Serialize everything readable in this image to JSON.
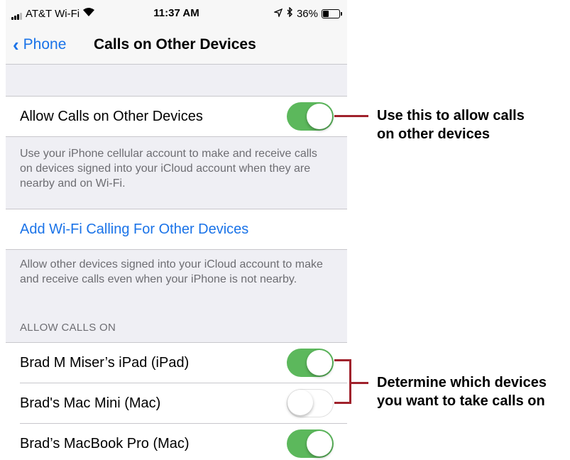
{
  "status_bar": {
    "carrier": "AT&T Wi-Fi",
    "time": "11:37 AM",
    "battery": "36%"
  },
  "nav": {
    "back_label": "Phone",
    "title": "Calls on Other Devices"
  },
  "allow_calls": {
    "label": "Allow Calls on Other Devices",
    "enabled": true,
    "footer": "Use your iPhone cellular account to make and receive calls on devices signed into your iCloud account when they are nearby and on Wi-Fi."
  },
  "wifi_calling": {
    "label": "Add Wi-Fi Calling For Other Devices",
    "footer": "Allow other devices signed into your iCloud account to make and receive calls even when your iPhone is not nearby."
  },
  "allow_calls_on": {
    "header": "ALLOW CALLS ON",
    "devices": [
      {
        "label": "Brad M Miser’s iPad (iPad)",
        "enabled": true
      },
      {
        "label": "Brad's Mac Mini (Mac)",
        "enabled": false
      },
      {
        "label": "Brad’s MacBook Pro (Mac)",
        "enabled": true
      }
    ]
  },
  "callouts": {
    "allow_line1": "Use this to allow calls",
    "allow_line2": "on other devices",
    "devices_line1": "Determine which devices",
    "devices_line2": "you want to take calls on"
  },
  "colors": {
    "accent": "#1a73e8",
    "toggle_on": "#5cb85c",
    "callout_line": "#a0222c"
  }
}
